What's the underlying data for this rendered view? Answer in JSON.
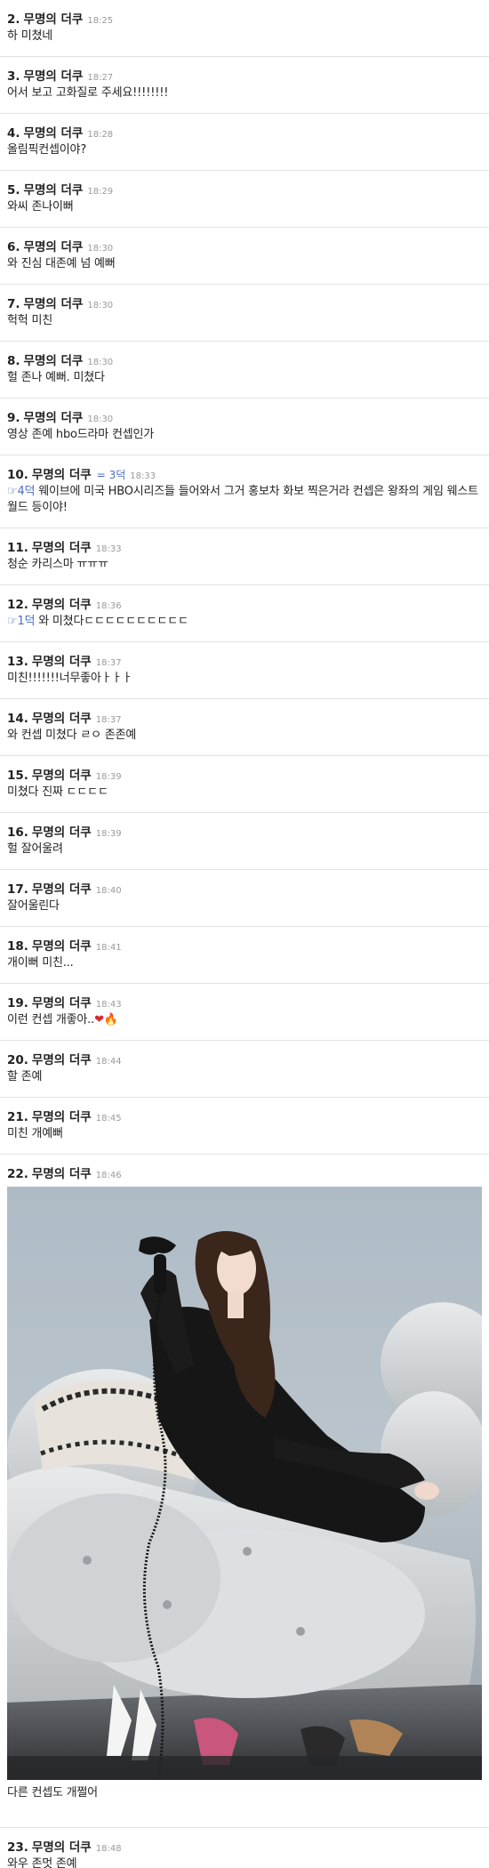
{
  "comments": [
    {
      "number": "2.",
      "author": "무명의 더쿠",
      "time": "18:25",
      "text": "하 미쳤네"
    },
    {
      "number": "3.",
      "author": "무명의 더쿠",
      "time": "18:27",
      "text": "어서 보고 고화질로 주세요!!!!!!!!"
    },
    {
      "number": "4.",
      "author": "무명의 더쿠",
      "time": "18:28",
      "text": "올림픽컨셉이야?"
    },
    {
      "number": "5.",
      "author": "무명의 더쿠",
      "time": "18:29",
      "text": "와씨 존나이뻐"
    },
    {
      "number": "6.",
      "author": "무명의 더쿠",
      "time": "18:30",
      "text": "와 진심 대존예 넘 예뻐"
    },
    {
      "number": "7.",
      "author": "무명의 더쿠",
      "time": "18:30",
      "text": "헉헉 미친"
    },
    {
      "number": "8.",
      "author": "무명의 더쿠",
      "time": "18:30",
      "text": "헐 존나 예뻐. 미쳤다"
    },
    {
      "number": "9.",
      "author": "무명의 더쿠",
      "time": "18:30",
      "text": "영상 존예 hbo드라마 컨셉인가"
    },
    {
      "number": "10.",
      "author": "무명의 더쿠",
      "badge": "= 3덕",
      "time": "18:33",
      "ref": "☞4덕",
      "text": " 웨이브에 미국 HBO시리즈들 들어와서 그거 홍보차 화보 찍은거라 컨셉은 왕좌의 게임 웨스트월드 등이야!"
    },
    {
      "number": "11.",
      "author": "무명의 더쿠",
      "time": "18:33",
      "text": "청순 카리스마 ㅠㅠㅠ"
    },
    {
      "number": "12.",
      "author": "무명의 더쿠",
      "time": "18:36",
      "ref": "☞1덕",
      "text": " 와 미쳤다ㄷㄷㄷㄷㄷㄷㄷㄷㄷㄷ"
    },
    {
      "number": "13.",
      "author": "무명의 더쿠",
      "time": "18:37",
      "text": "미친!!!!!!!너무좋아ㅏㅏㅏ"
    },
    {
      "number": "14.",
      "author": "무명의 더쿠",
      "time": "18:37",
      "text": "와 컨셉 미쳤다 ㄹㅇ 존존예"
    },
    {
      "number": "15.",
      "author": "무명의 더쿠",
      "time": "18:39",
      "text": "미쳤다 진짜 ㄷㄷㄷㄷ"
    },
    {
      "number": "16.",
      "author": "무명의 더쿠",
      "time": "18:39",
      "text": "헐 잘어울려"
    },
    {
      "number": "17.",
      "author": "무명의 더쿠",
      "time": "18:40",
      "text": "잘어울린다"
    },
    {
      "number": "18.",
      "author": "무명의 더쿠",
      "time": "18:41",
      "text": "개이뻐 미친..."
    },
    {
      "number": "19.",
      "author": "무명의 더쿠",
      "time": "18:43",
      "text": "이런 컨셉 개좋아..",
      "emoji_heart": "❤",
      "emoji_fire": "🔥"
    },
    {
      "number": "20.",
      "author": "무명의 더쿠",
      "time": "18:44",
      "text": "할 존예"
    },
    {
      "number": "21.",
      "author": "무명의 더쿠",
      "time": "18:45",
      "text": "미친 개예뻐"
    },
    {
      "number": "22.",
      "author": "무명의 더쿠",
      "time": "18:46",
      "text": "다른 컨셉도 개쩔어"
    },
    {
      "number": "23.",
      "author": "무명의 더쿠",
      "time": "18:48",
      "text": "와우 존멋 존예"
    }
  ],
  "colors": {
    "link": "#4a6cc4",
    "time": "#9a9a9a",
    "divider": "#e2e2e2"
  }
}
